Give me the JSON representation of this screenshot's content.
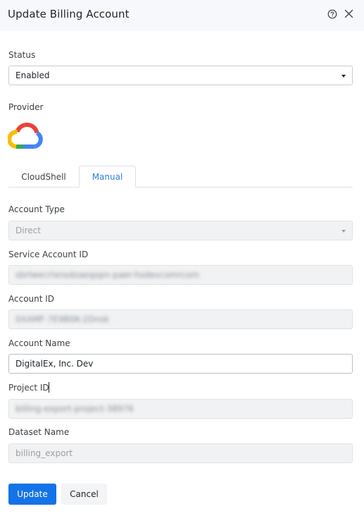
{
  "dialog": {
    "title": "Update Billing Account",
    "help_icon": "question-circle-icon",
    "close_icon": "close-icon"
  },
  "status": {
    "label": "Status",
    "value": "Enabled"
  },
  "provider": {
    "label": "Provider",
    "logo_icon": "google-cloud-logo-icon"
  },
  "tabs": [
    {
      "label": "CloudShell",
      "active": false
    },
    {
      "label": "Manual",
      "active": true
    }
  ],
  "form": {
    "account_type": {
      "label": "Account Type",
      "value": "Direct"
    },
    "service_account_id": {
      "label": "Service Account ID",
      "value": "sbrlwecrlxnsdzaeqopn-paer-hsdevcomrcom"
    },
    "account_id": {
      "label": "Account ID",
      "value": "0XAMF-7E9B0K-2Dnsk"
    },
    "account_name": {
      "label": "Account Name",
      "value": "DigitalEx, Inc. Dev"
    },
    "project_id": {
      "label": "Project ID",
      "value": "billing-export-project-38976"
    },
    "dataset_name": {
      "label": "Dataset Name",
      "value": "billing_export"
    }
  },
  "actions": {
    "update_label": "Update",
    "cancel_label": "Cancel"
  },
  "colors": {
    "primary": "#1473e6",
    "active_tab": "#2f7de1",
    "header_bg": "#f6f8fc"
  }
}
